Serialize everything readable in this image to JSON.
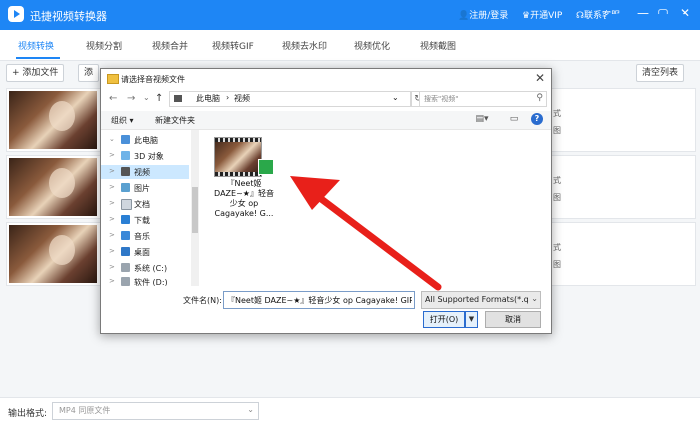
{
  "app": {
    "title": "迅捷视频转换器",
    "login": "注册/登录",
    "vip": "开通VIP",
    "service": "联系客服",
    "icons": [
      "user-icon",
      "vip-crown-icon",
      "headset-icon"
    ]
  },
  "window_controls": {
    "minimize": "—",
    "maximize": "▢",
    "close": "✕"
  },
  "tabs": [
    "视频转换",
    "视频分割",
    "视频合并",
    "视频转GIF",
    "视频去水印",
    "视频优化",
    "视频截图"
  ],
  "toolbar": {
    "add_file": "+ 添加文件",
    "add_folder": "添",
    "clear_list": "清空列表"
  },
  "rows": [
    {
      "side_top": "式",
      "side_bottom": "图"
    },
    {
      "side_top": "式",
      "side_bottom": "图"
    },
    {
      "side_top": "式",
      "side_bottom": "图"
    }
  ],
  "output": {
    "label": "输出格式:",
    "value": "MP4  同原文件"
  },
  "dialog": {
    "title": "请选择音视频文件",
    "nav": {
      "back": "←",
      "forward": "→",
      "recent": "⌄",
      "up": "↑"
    },
    "breadcrumb": [
      "此电脑",
      "›",
      "视频",
      "⌄"
    ],
    "refresh": "↻",
    "search_placeholder": "搜索\"视频\"",
    "commands": {
      "organize": "组织 ▾",
      "new_folder": "新建文件夹"
    },
    "view_icons": {
      "view": "▤▾",
      "preview": "▭"
    },
    "help": "?",
    "tree": [
      {
        "label": "此电脑",
        "icon": "computer-icon",
        "arrow": "⌄",
        "selected": false
      },
      {
        "label": "3D 对象",
        "icon": "3d-objects-icon",
        "arrow": ">",
        "selected": false
      },
      {
        "label": "视频",
        "icon": "video-folder-icon",
        "arrow": ">",
        "selected": true
      },
      {
        "label": "图片",
        "icon": "pictures-icon",
        "arrow": ">",
        "selected": false
      },
      {
        "label": "文档",
        "icon": "documents-icon",
        "arrow": ">",
        "selected": false
      },
      {
        "label": "下载",
        "icon": "download-icon",
        "arrow": ">",
        "selected": false
      },
      {
        "label": "音乐",
        "icon": "music-icon",
        "arrow": ">",
        "selected": false
      },
      {
        "label": "桌面",
        "icon": "desktop-icon",
        "arrow": ">",
        "selected": false
      },
      {
        "label": "系统 (C:)",
        "icon": "drive-icon",
        "arrow": ">",
        "selected": false
      },
      {
        "label": "软件 (D:)",
        "icon": "drive-icon",
        "arrow": ">",
        "selected": false
      }
    ],
    "file": {
      "name_lines": [
        "『Neet姬",
        "DAZE~★』轻音",
        "少女 op",
        "Cagayake! G..."
      ]
    },
    "filename_label": "文件名(N):",
    "filename_value": "『Neet姬 DAZE~★』轻音少女 op Cagayake! GIR",
    "filter": "All Supported Formats(*.qlv;",
    "open": "打开(O)",
    "open_dropdown": "▼",
    "cancel": "取消"
  },
  "colors": {
    "accent": "#1e86f5",
    "annotation_arrow": "#e8201a"
  }
}
